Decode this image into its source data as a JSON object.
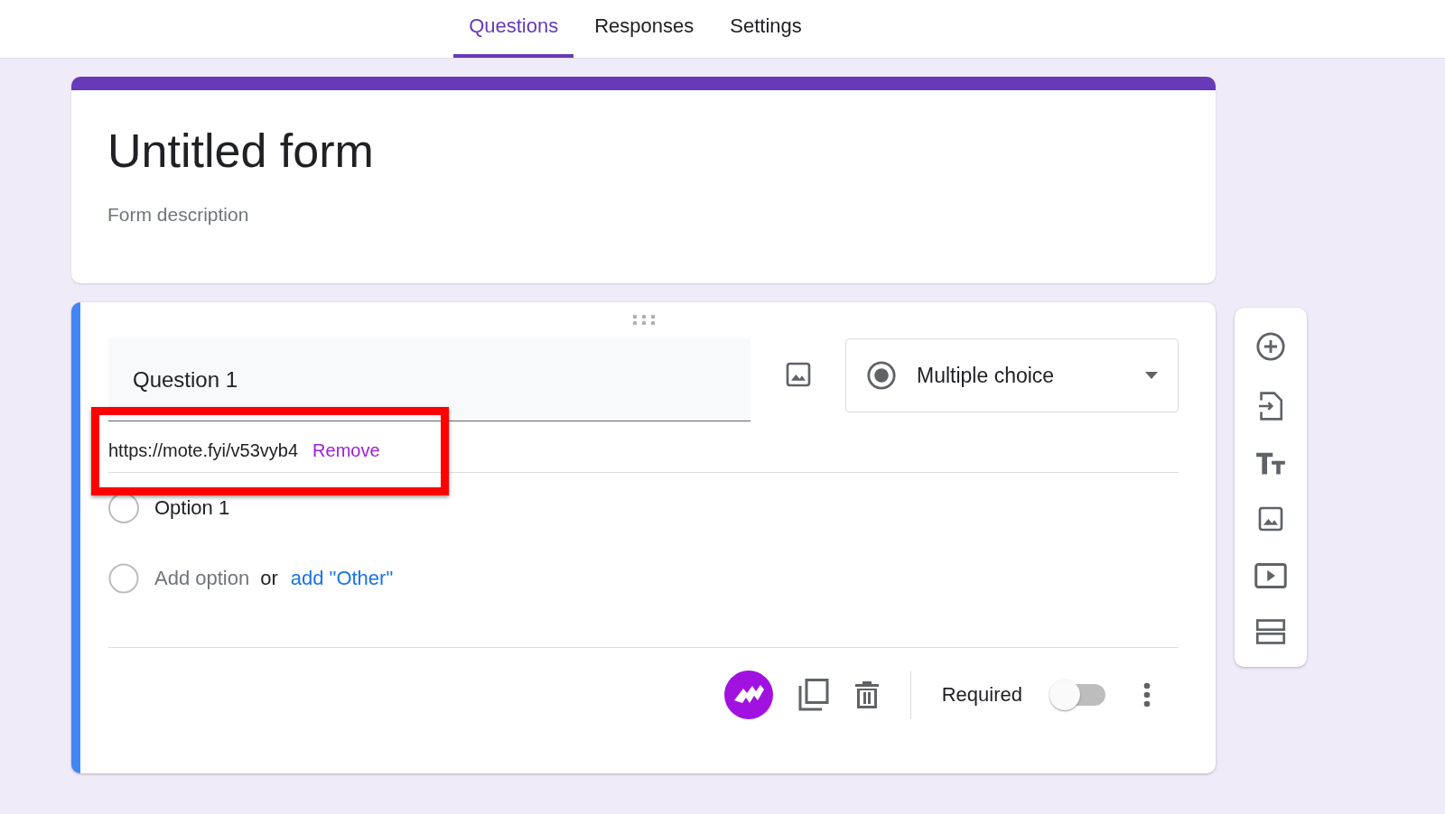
{
  "tabs": [
    {
      "label": "Questions",
      "selected": true
    },
    {
      "label": "Responses",
      "selected": false
    },
    {
      "label": "Settings",
      "selected": false
    }
  ],
  "form": {
    "title": "Untitled form",
    "description_placeholder": "Form description"
  },
  "question": {
    "title": "Question 1",
    "type": "Multiple choice",
    "link": {
      "url": "https://mote.fyi/v53vyb4",
      "action": "Remove",
      "highlighted": true
    },
    "options": [
      {
        "label": "Option 1",
        "selected": false
      }
    ],
    "add_option": "Add option",
    "or": "or",
    "add_other": "add \"Other\"",
    "required_label": "Required",
    "required": false
  }
}
